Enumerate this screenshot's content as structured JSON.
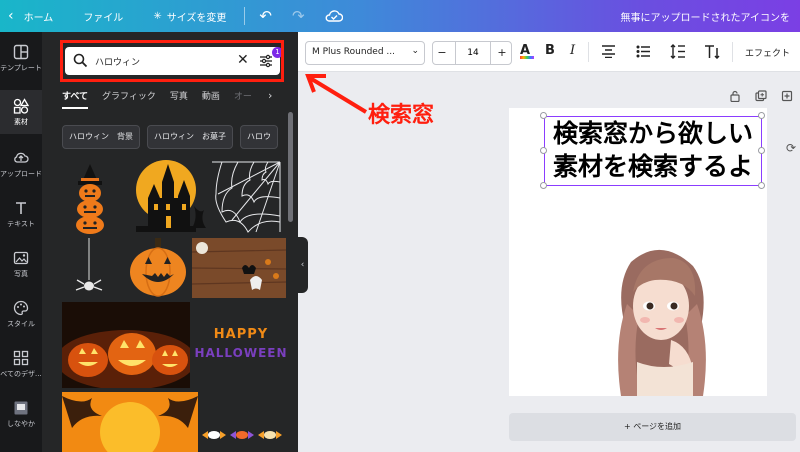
{
  "topbar": {
    "home_label": "ホーム",
    "file_label": "ファイル",
    "resize_label": "サイズを変更",
    "notice": "無事にアップロードされたアイコンを"
  },
  "sidebar": {
    "items": [
      {
        "label": "テンプレート",
        "icon": "template-icon"
      },
      {
        "label": "素材",
        "icon": "elements-icon"
      },
      {
        "label": "アップロード",
        "icon": "upload-icon"
      },
      {
        "label": "テキスト",
        "icon": "text-icon"
      },
      {
        "label": "写真",
        "icon": "photo-icon"
      },
      {
        "label": "スタイル",
        "icon": "palette-icon"
      },
      {
        "label": "べてのデザ...",
        "icon": "grid-icon"
      },
      {
        "label": "しなやか",
        "icon": "folder-icon"
      }
    ]
  },
  "search": {
    "value": "ハロウィン",
    "filter_count": "1"
  },
  "tabs": [
    "すべて",
    "グラフィック",
    "写真",
    "動画",
    "オー"
  ],
  "chips": [
    "ハロウィン　背景",
    "ハロウィン　お菓子",
    "ハロウ"
  ],
  "results": {
    "halloween_letters": [
      "HAPPY",
      "HALLOWEEN"
    ]
  },
  "toolbar": {
    "font": "M Plus Rounded ...",
    "font_size": "14",
    "effect_label": "エフェクト"
  },
  "canvas": {
    "text_line1": "検索窓から欲しい",
    "text_line2": "素材を検索するよ",
    "add_page_label": "+ ページを追加"
  },
  "annotation": {
    "label": "検索窓",
    "color": "#ff1f0f"
  },
  "colors": {
    "accent": "#7d2ae8",
    "selection": "#8b3dff",
    "panel_bg": "#252627",
    "rail_bg": "#18191b"
  }
}
